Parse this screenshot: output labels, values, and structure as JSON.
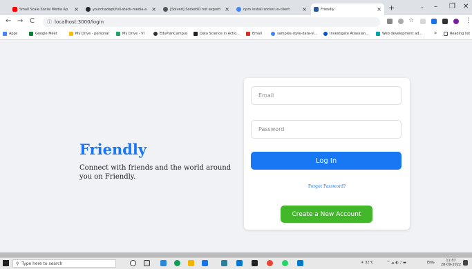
{
  "tabs": [
    {
      "title": "Small Scale Social Media Ap",
      "color": "#ff0000"
    },
    {
      "title": "yourchadapt/full-stack-media-a",
      "color": "#24292e"
    },
    {
      "title": "[Solved] SocketIO not exporti",
      "color": "#555555"
    },
    {
      "title": "npm install socket.io-client",
      "color": "#4285f4"
    },
    {
      "title": "Friendly",
      "color": "#2b579a"
    }
  ],
  "new_tab": "+",
  "window_controls": {
    "min": "–",
    "max": "❐",
    "close": "✕"
  },
  "url": "localhost:3000/login",
  "bookmarks": [
    {
      "label": "Apps",
      "color": "#4285f4"
    },
    {
      "label": "Google Meet",
      "color": "#00832d"
    },
    {
      "label": "My Drive - personal",
      "color": "#fbbc04"
    },
    {
      "label": "My Drive - VI",
      "color": "#1fa463"
    },
    {
      "label": "EduPlanCampus",
      "color": "#333333"
    },
    {
      "label": "Data Science in Actio...",
      "color": "#222222"
    },
    {
      "label": "Email",
      "color": "#d93025"
    },
    {
      "label": "samples-style-data-vi...",
      "color": "#4285f4"
    },
    {
      "label": "Investigate Atlassian...",
      "color": "#0052cc"
    },
    {
      "label": "Web development ad...",
      "color": "#00a4a6"
    }
  ],
  "reading_list": "Reading list",
  "brand": "Friendly",
  "tagline": "Connect with friends and the world around you on Friendly.",
  "login": {
    "email_placeholder": "Email",
    "password_placeholder": "Password",
    "login_label": "Log In",
    "forgot_label": "Forgot Password?",
    "create_label": "Create a New Account"
  },
  "taskbar": {
    "search_placeholder": "Type here to search",
    "weather": "32°C",
    "lang": "ENG",
    "time": "11:07",
    "date": "28-09-2022"
  },
  "colors": {
    "primary": "#1877f2",
    "success": "#42b72a",
    "background": "#f0f2f5"
  }
}
